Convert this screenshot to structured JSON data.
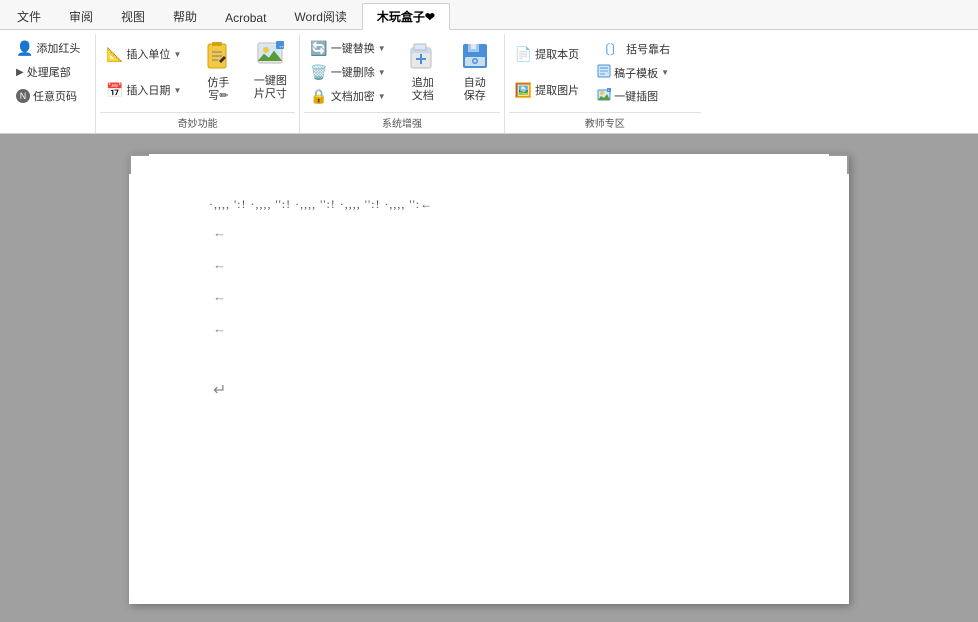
{
  "tabs": [
    {
      "id": "file",
      "label": "文件"
    },
    {
      "id": "audit",
      "label": "审阅"
    },
    {
      "id": "view",
      "label": "视图"
    },
    {
      "id": "help",
      "label": "帮助"
    },
    {
      "id": "acrobat",
      "label": "Acrobat"
    },
    {
      "id": "word-reader",
      "label": "Word阅读"
    },
    {
      "id": "fam",
      "label": "木玩盒子❤",
      "active": true
    }
  ],
  "ribbon": {
    "sections": [
      {
        "id": "left-tools",
        "items_small": [
          {
            "id": "add-header",
            "icon": "👤",
            "label": "添加红头",
            "has_icon_prefix": true
          },
          {
            "id": "process-tail",
            "icon": "▶",
            "label": "处理尾部"
          },
          {
            "id": "any-page-code",
            "icon": "ⓝ",
            "label": "任意页码"
          }
        ]
      },
      {
        "id": "qi-miao",
        "label": "奇妙功能",
        "items": [
          {
            "id": "insert-unit",
            "icon": "📐",
            "label": "插入单位",
            "dropdown": true,
            "size": "small"
          },
          {
            "id": "insert-date",
            "icon": "📅",
            "label": "插入日期",
            "dropdown": true,
            "size": "small"
          },
          {
            "id": "faux-write",
            "icon": "✏️",
            "label": "仿手写",
            "size": "large"
          },
          {
            "id": "one-key-size",
            "icon": "🖼️",
            "label": "一键图\n片尺寸",
            "size": "large"
          }
        ]
      },
      {
        "id": "system-enhance",
        "label": "系统增强",
        "items": [
          {
            "id": "one-replace",
            "icon": "🔄",
            "label": "一键替换",
            "dropdown": true,
            "size": "small"
          },
          {
            "id": "one-delete",
            "icon": "🗑️",
            "label": "一键删除",
            "dropdown": true,
            "size": "small"
          },
          {
            "id": "doc-encrypt",
            "icon": "🔒",
            "label": "文档加密",
            "dropdown": true,
            "size": "small"
          },
          {
            "id": "add-archive",
            "icon": "📁",
            "label": "追加\n文档",
            "size": "large"
          },
          {
            "id": "auto-save",
            "icon": "💾",
            "label": "自动\n保存",
            "size": "large"
          }
        ]
      },
      {
        "id": "teacher-zone",
        "label": "教师专区",
        "items": [
          {
            "id": "extract-page",
            "icon": "📄",
            "label": "提取本页",
            "size": "small"
          },
          {
            "id": "extract-image",
            "icon": "🖼️",
            "label": "提取图片",
            "size": "small"
          },
          {
            "id": "bracket-right",
            "icon": "〕",
            "label": "括号靠右",
            "size": "small"
          },
          {
            "id": "draft-template",
            "icon": "📝",
            "label": "稿子模板",
            "dropdown": true,
            "size": "small"
          },
          {
            "id": "one-insert",
            "icon": "🖼️",
            "label": "一键插图",
            "size": "small"
          }
        ]
      }
    ]
  },
  "document": {
    "lines": [
      {
        "id": "line1",
        "text": "·,,,,  ':!  ·,,,,  '':!  ·,,,,  '':!  ·,,,,  '':!  ·,,,,  '':←",
        "type": "text"
      },
      {
        "id": "line2",
        "text": "",
        "type": "paragraph"
      },
      {
        "id": "line3",
        "text": "",
        "type": "paragraph"
      },
      {
        "id": "line4",
        "text": "",
        "type": "paragraph"
      },
      {
        "id": "line5",
        "text": "",
        "type": "paragraph"
      },
      {
        "id": "line6",
        "text": "",
        "type": "paragraph-large"
      }
    ]
  },
  "colors": {
    "ribbon_bg": "#ffffff",
    "tab_active_bg": "#4472c4",
    "tab_active_text": "#ffffff",
    "doc_bg": "#a0a0a0",
    "page_bg": "#ffffff"
  }
}
